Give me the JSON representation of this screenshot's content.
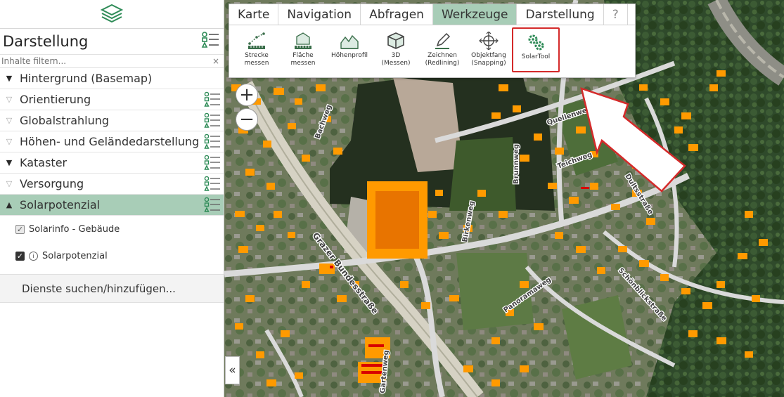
{
  "sidebar": {
    "title": "Darstellung",
    "filter_placeholder": "Inhalte filtern...",
    "filter_clear": "×",
    "layers": [
      {
        "label": "Hintergrund (Basemap)",
        "state": "expanded",
        "legend": false
      },
      {
        "label": "Orientierung",
        "state": "collapsed",
        "legend": true
      },
      {
        "label": "Globalstrahlung",
        "state": "collapsed",
        "legend": true
      },
      {
        "label": "Höhen- und Geländedarstellung",
        "state": "collapsed",
        "legend": true
      },
      {
        "label": "Kataster",
        "state": "expanded",
        "legend": true
      },
      {
        "label": "Versorgung",
        "state": "collapsed",
        "legend": true
      },
      {
        "label": "Solarpotenzial",
        "state": "selected",
        "legend": true
      }
    ],
    "sublayers": [
      {
        "label": "Solarinfo - Gebäude",
        "checked": true
      },
      {
        "label": "Solarpotenzial",
        "checked": true
      }
    ],
    "add_services": "Dienste suchen/hinzufügen..."
  },
  "toolbar": {
    "tabs": [
      "Karte",
      "Navigation",
      "Abfragen",
      "Werkzeuge",
      "Darstellung",
      "?"
    ],
    "active_tab": "Werkzeuge",
    "tools": [
      {
        "label": "Strecke\nmessen",
        "icon": "measure-line-icon"
      },
      {
        "label": "Fläche\nmessen",
        "icon": "measure-area-icon"
      },
      {
        "label": "Höhenprofil",
        "icon": "elevation-profile-icon"
      },
      {
        "label": "3D\n(Messen)",
        "icon": "cube-3d-icon"
      },
      {
        "label": "Zeichnen\n(Redlining)",
        "icon": "pencil-icon"
      },
      {
        "label": "Objektfang\n(Snapping)",
        "icon": "crosshair-icon"
      },
      {
        "label": "SolarTool",
        "icon": "gears-icon"
      }
    ],
    "highlighted_tool": "SolarTool"
  },
  "map": {
    "zoom_in": "+",
    "zoom_out": "−",
    "collapse": "«",
    "streets": [
      {
        "label": "Grazer Bundesstraße"
      },
      {
        "label": "Bachweg"
      },
      {
        "label": "Brunnweg"
      },
      {
        "label": "Quellenweg"
      },
      {
        "label": "Birkenweg"
      },
      {
        "label": "Teichweg"
      },
      {
        "label": "Panoramaweg"
      },
      {
        "label": "Schönblickstraße"
      },
      {
        "label": "Dultsstraße"
      },
      {
        "label": "Gartenweg"
      }
    ],
    "colors": {
      "solar_high": "#ff9a00",
      "solar_medium": "#e87400",
      "accent_green": "#a8cdb7",
      "highlight_red": "#d42a2a"
    }
  }
}
